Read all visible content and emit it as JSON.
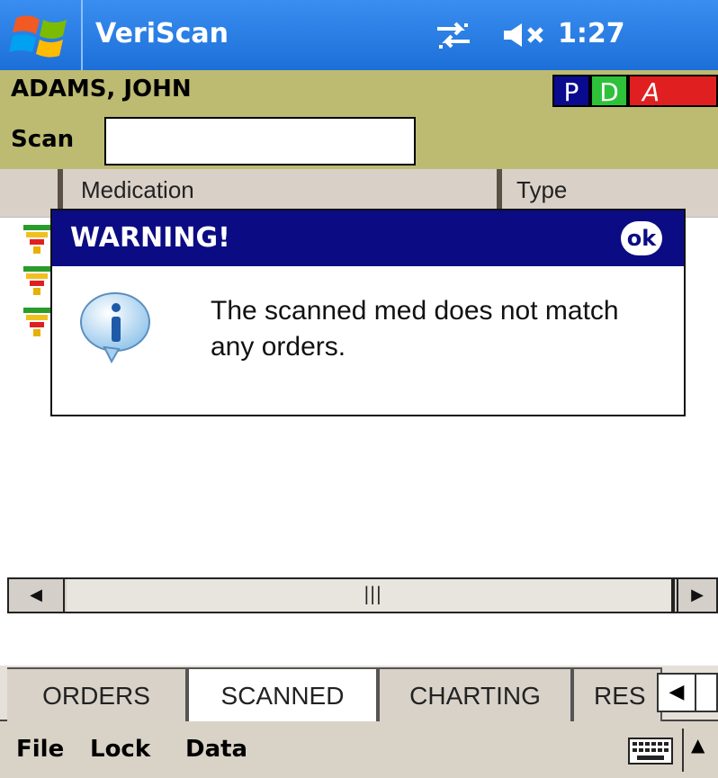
{
  "titlebar": {
    "app_title": "VeriScan",
    "time": "1:27",
    "icons": [
      "windows-start-icon",
      "connectivity-icon",
      "volume-muted-icon"
    ]
  },
  "patient": {
    "name": "ADAMS, JOHN",
    "flags": [
      "P",
      "D",
      "A"
    ],
    "scan_label": "Scan",
    "scan_value": ""
  },
  "columns": [
    "Medication",
    "Type"
  ],
  "dialog": {
    "title": "WARNING!",
    "ok_label": "ok",
    "message": "The scanned med does not match any orders."
  },
  "tabs": [
    "ORDERS",
    "SCANNED",
    "CHARTING",
    "RES"
  ],
  "active_tab": "SCANNED",
  "menu": [
    "File",
    "Lock",
    "Data"
  ],
  "colors": {
    "titlebar": "#1c6fd8",
    "patient_bar": "#bdbb72",
    "dialog_title": "#0b0c84"
  }
}
